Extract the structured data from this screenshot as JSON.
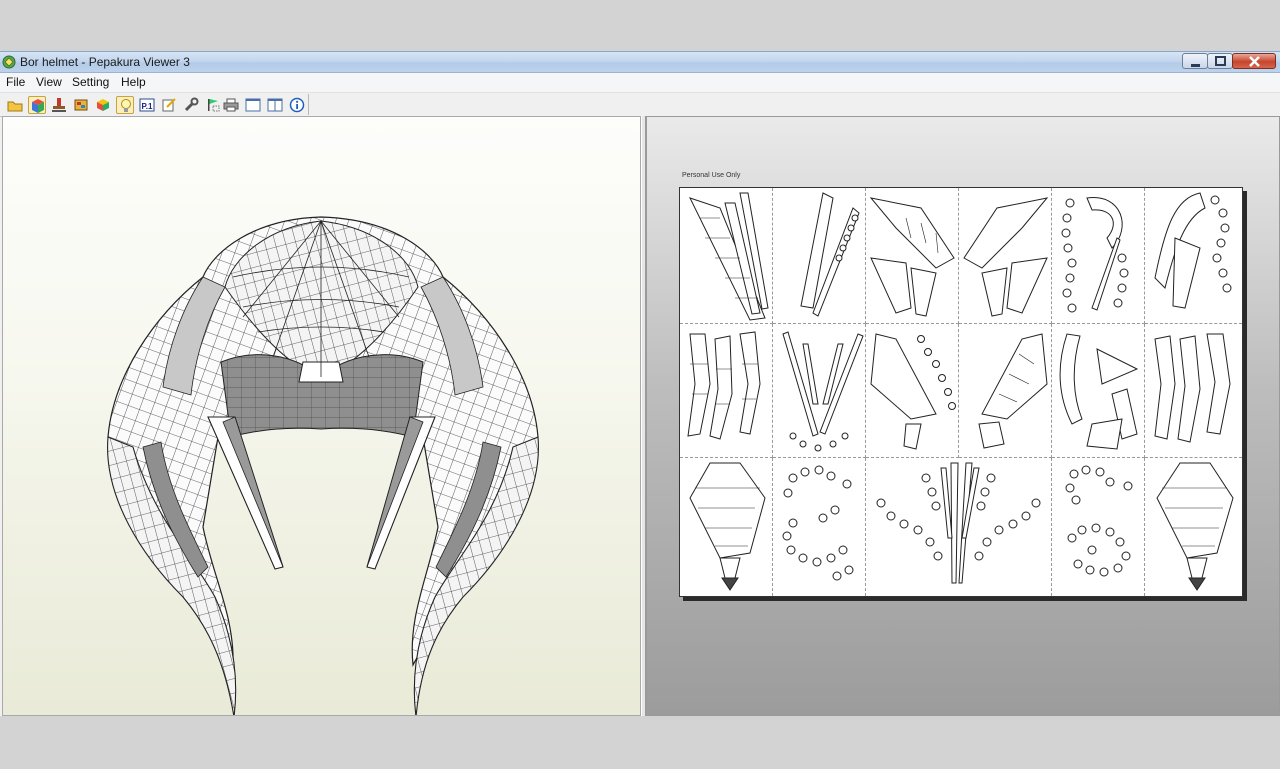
{
  "window": {
    "title": "Bor helmet - Pepakura Viewer 3",
    "app_icon": "pepakura-app-icon",
    "controls": [
      "minimize-icon",
      "maximize-icon",
      "close-icon"
    ]
  },
  "menu": {
    "file": "File",
    "view": "View",
    "setting": "Setting",
    "help": "Help"
  },
  "toolbar": {
    "buttons": [
      {
        "icon": "open-folder-icon"
      },
      {
        "icon": "3d-view-cube-icon",
        "pressed": true
      },
      {
        "icon": "stamp-icon"
      },
      {
        "icon": "texture-icon"
      },
      {
        "icon": "box-color-icon"
      },
      {
        "icon": "lightbulb-icon",
        "pressed": true
      },
      {
        "icon": "page-number-icon"
      },
      {
        "icon": "edge-settings-icon"
      },
      {
        "icon": "wrench-icon"
      },
      {
        "icon": "flag-icon"
      },
      {
        "icon": "printer-icon"
      },
      {
        "icon": "single-pane-icon"
      },
      {
        "icon": "split-pane-icon"
      },
      {
        "icon": "info-icon"
      }
    ],
    "page_label": "P.1"
  },
  "view3d": {
    "model": "helmet-3d-model"
  },
  "view2d": {
    "watermark": "Personal Use Only",
    "grid": {
      "columns": 6,
      "rows": 3
    }
  },
  "colors": {
    "titlebar": "#c3d6ee",
    "close_button": "#c7452c",
    "view3d_background": "#f7f8ef",
    "view2d_background": "#bdbdbd",
    "model_dark": "#8c8c8c",
    "model_light": "#ffffff"
  }
}
